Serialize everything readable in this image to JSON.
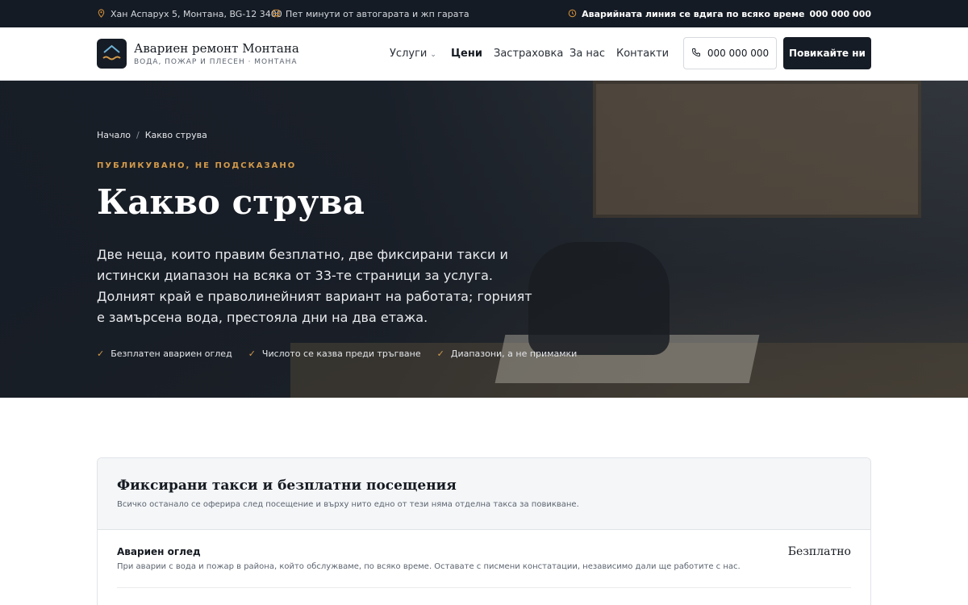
{
  "topbar": {
    "address": "Хан Аспарух 5, Монтана, BG-12 3400",
    "transport": "Пет минути от автогарата и жп гарата",
    "hotline_label": "Аварийната линия се вдига по всяко време",
    "hotline_phone": "000 000 000",
    "icons": [
      "map-pin-icon",
      "bus-icon",
      "clock-icon"
    ],
    "accent_color": "#c98a3a"
  },
  "header": {
    "brand_name": "Авариен ремонт Монтана",
    "brand_tagline": "ВОДА, ПОЖАР И ПЛЕСЕН · МОНТАНА",
    "nav": [
      {
        "label": "Услуги",
        "has_dropdown": true
      },
      {
        "label": "Цени",
        "active": true
      },
      {
        "label": "Застраховка"
      },
      {
        "label": "За нас"
      },
      {
        "label": "Контакти"
      }
    ],
    "phone_button": "000 000 000",
    "cta_button": "Повикайте ни",
    "dark_color": "#161c25"
  },
  "hero": {
    "breadcrumb": [
      "Начало",
      "Какво струва"
    ],
    "breadcrumb_separator": "/",
    "eyebrow": "ПУБЛИКУВАНО, НЕ ПОДСКАЗАНО",
    "title": "Какво струва",
    "lead": "Две неща, които правим безплатно, две фиксирани такси и истински диапазон на всяка от 33-те страници за услуга. Долният край е праволинейният вариант на работата; горният е замърсена вода, престояла дни на два етажа.",
    "checks": [
      "Безплатен авариен оглед",
      "Числото се казва преди тръгване",
      "Диапазони, а не примамки"
    ],
    "accent_color": "#d39a4a"
  },
  "pricing": {
    "title": "Фиксирани такси и безплатни посещения",
    "subtitle": "Всичко останало се оферира след посещение и върху нито едно от тези няма отделна такса за повикване.",
    "rows": [
      {
        "name": "Авариен оглед",
        "description": "При аварии с вода и пожар в района, който обслужваме, по всяко време. Оставате с писмени констатации, независимо дали ще работите с нас.",
        "price": "Безплатно"
      }
    ]
  }
}
